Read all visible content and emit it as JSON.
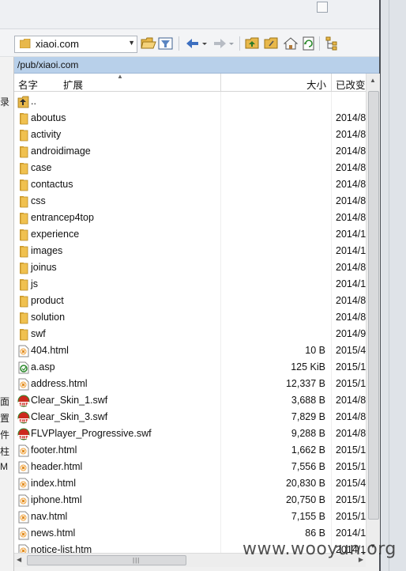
{
  "toolbar": {
    "path_value": "xiaoi.com"
  },
  "path_bar": "/pub/xiaoi.com",
  "columns": {
    "name": "名字",
    "ext": "扩展",
    "size": "大小",
    "modified": "已改变"
  },
  "left_panel_chars": [
    "录",
    "面",
    "置",
    "件",
    "柱",
    "M"
  ],
  "files": [
    {
      "name": "..",
      "size": "",
      "date": "",
      "type": "up"
    },
    {
      "name": "aboutus",
      "size": "",
      "date": "2014/8",
      "type": "folder"
    },
    {
      "name": "activity",
      "size": "",
      "date": "2014/8",
      "type": "folder"
    },
    {
      "name": "androidimage",
      "size": "",
      "date": "2014/8",
      "type": "folder"
    },
    {
      "name": "case",
      "size": "",
      "date": "2014/8",
      "type": "folder"
    },
    {
      "name": "contactus",
      "size": "",
      "date": "2014/8",
      "type": "folder"
    },
    {
      "name": "css",
      "size": "",
      "date": "2014/8",
      "type": "folder"
    },
    {
      "name": "entrancep4top",
      "size": "",
      "date": "2014/8",
      "type": "folder"
    },
    {
      "name": "experience",
      "size": "",
      "date": "2014/1",
      "type": "folder"
    },
    {
      "name": "images",
      "size": "",
      "date": "2014/1",
      "type": "folder"
    },
    {
      "name": "joinus",
      "size": "",
      "date": "2014/8",
      "type": "folder"
    },
    {
      "name": "js",
      "size": "",
      "date": "2014/1",
      "type": "folder"
    },
    {
      "name": "product",
      "size": "",
      "date": "2014/8",
      "type": "folder"
    },
    {
      "name": "solution",
      "size": "",
      "date": "2014/8",
      "type": "folder"
    },
    {
      "name": "swf",
      "size": "",
      "date": "2014/9",
      "type": "folder"
    },
    {
      "name": "404.html",
      "size": "10 B",
      "date": "2015/4",
      "type": "html"
    },
    {
      "name": "a.asp",
      "size": "125 KiB",
      "date": "2015/1",
      "type": "asp"
    },
    {
      "name": "address.html",
      "size": "12,337 B",
      "date": "2015/1",
      "type": "html"
    },
    {
      "name": "Clear_Skin_1.swf",
      "size": "3,688 B",
      "date": "2014/8",
      "type": "swf"
    },
    {
      "name": "Clear_Skin_3.swf",
      "size": "7,829 B",
      "date": "2014/8",
      "type": "swf"
    },
    {
      "name": "FLVPlayer_Progressive.swf",
      "size": "9,288 B",
      "date": "2014/8",
      "type": "swf"
    },
    {
      "name": "footer.html",
      "size": "1,662 B",
      "date": "2015/1",
      "type": "html"
    },
    {
      "name": "header.html",
      "size": "7,556 B",
      "date": "2015/1",
      "type": "html"
    },
    {
      "name": "index.html",
      "size": "20,830 B",
      "date": "2015/4",
      "type": "html"
    },
    {
      "name": "iphone.html",
      "size": "20,750 B",
      "date": "2015/1",
      "type": "html"
    },
    {
      "name": "nav.html",
      "size": "7,155 B",
      "date": "2015/1",
      "type": "html"
    },
    {
      "name": "news.html",
      "size": "86 B",
      "date": "2014/1",
      "type": "html"
    },
    {
      "name": "notice-list.htm",
      "size": "",
      "date": "2014/1",
      "type": "html"
    }
  ],
  "watermark": "www.wooyun.org",
  "colors": {
    "path_bar": "#b8d0ea",
    "folder": "#e8b84a",
    "swf_red": "#cc2a1e",
    "asp_green": "#2f8a2f"
  }
}
